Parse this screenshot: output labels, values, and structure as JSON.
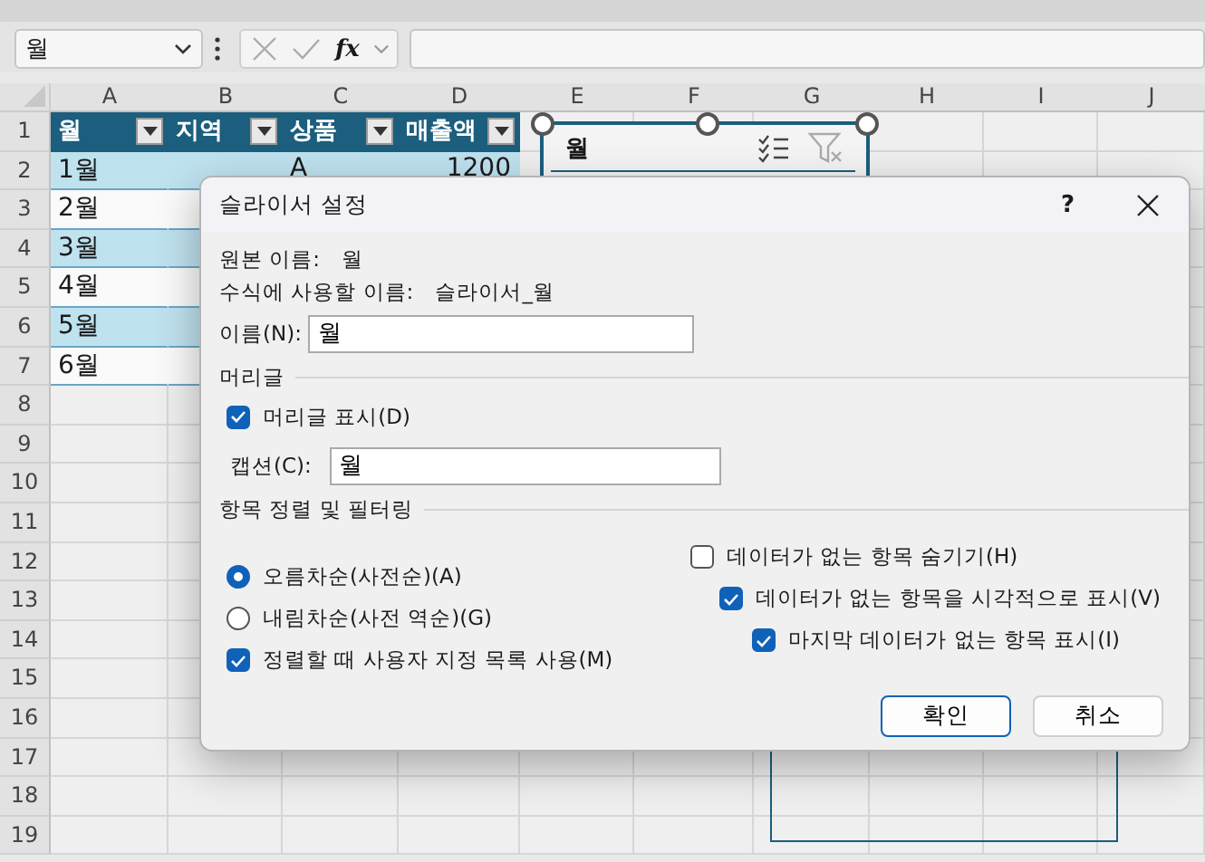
{
  "name_box": {
    "value": "월"
  },
  "formula_bar": {
    "fx": "fx"
  },
  "sheet": {
    "columns": [
      "A",
      "B",
      "C",
      "D",
      "E",
      "F",
      "G",
      "H",
      "I",
      "J"
    ],
    "row_numbers": [
      "1",
      "2",
      "3",
      "4",
      "5",
      "6",
      "7",
      "8",
      "9",
      "10",
      "11",
      "12",
      "13",
      "14",
      "15",
      "16",
      "17",
      "18",
      "19"
    ]
  },
  "table": {
    "columns": [
      "월",
      "지역",
      "상품",
      "매출액"
    ],
    "rows": [
      {
        "month": "1월",
        "product": "A",
        "sales": "1200"
      },
      {
        "month": "2월"
      },
      {
        "month": "3월"
      },
      {
        "month": "4월"
      },
      {
        "month": "5월"
      },
      {
        "month": "6월"
      }
    ]
  },
  "slicer": {
    "title": "월"
  },
  "dialog": {
    "title": "슬라이서 설정",
    "help": "?",
    "source_name": {
      "label": "원본 이름:",
      "value": "월"
    },
    "formula_name": {
      "label": "수식에 사용할 이름:",
      "value": "슬라이서_월"
    },
    "name_field": {
      "label": "이름(N):",
      "value": "월"
    },
    "header": {
      "title": "머리글",
      "show_header": {
        "label": "머리글 표시(D)",
        "checked": true
      },
      "caption": {
        "label": "캡션(C):",
        "value": "월"
      }
    },
    "sorting": {
      "title": "항목 정렬 및 필터링",
      "options": [
        {
          "label": "오름차순(사전순)(A)",
          "selected": true
        },
        {
          "label": "내림차순(사전 역순)(G)",
          "selected": false
        }
      ],
      "custom_list": {
        "label": "정렬할 때 사용자 지정 목록 사용(M)",
        "checked": true
      },
      "filters": [
        {
          "label": "데이터가 없는 항목 숨기기(H)",
          "checked": false,
          "children": [
            {
              "label": "데이터가 없는 항목을 시각적으로 표시(V)",
              "checked": true,
              "children": [
                {
                  "label": "마지막 데이터가 없는 항목 표시(I)",
                  "checked": true
                }
              ]
            }
          ]
        }
      ]
    },
    "buttons": [
      {
        "label": "확인",
        "default": true
      },
      {
        "label": "취소",
        "default": false
      }
    ]
  }
}
